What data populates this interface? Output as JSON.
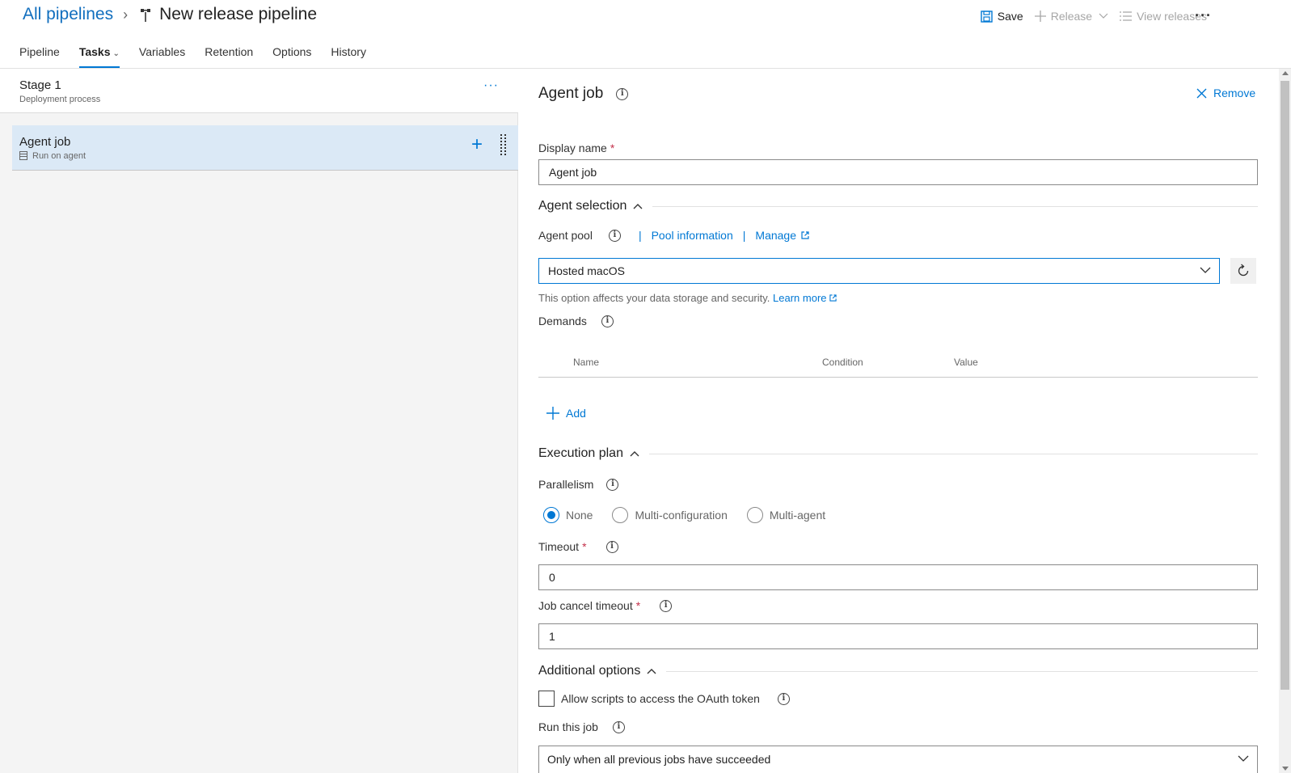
{
  "breadcrumb": {
    "parent": "All pipelines",
    "title": "New release pipeline"
  },
  "toolbar": {
    "save_label": "Save",
    "release_label": "Release",
    "view_releases_label": "View releases",
    "more_label": "···"
  },
  "tabs": [
    {
      "label": "Pipeline"
    },
    {
      "label": "Tasks"
    },
    {
      "label": "Variables"
    },
    {
      "label": "Retention"
    },
    {
      "label": "Options"
    },
    {
      "label": "History"
    }
  ],
  "left_panel": {
    "stage_title": "Stage 1",
    "stage_subtitle": "Deployment process",
    "stage_more": "···",
    "job_title": "Agent job",
    "job_subtitle": "Run on agent",
    "job_add": "+"
  },
  "right_panel": {
    "title": "Agent job",
    "remove_label": "Remove",
    "display_name_label": "Display name",
    "display_name_value": "Agent job",
    "agent_selection_label": "Agent selection",
    "agent_pool_label": "Agent pool",
    "pool_information_link": "Pool information",
    "manage_link": "Manage",
    "agent_pool_value": "Hosted macOS",
    "help_text": "This option affects your data storage and security.",
    "learn_more_link": "Learn more",
    "demands_label": "Demands",
    "demands_columns": [
      "Name",
      "Condition",
      "Value"
    ],
    "add_label": "Add",
    "execution_plan_label": "Execution plan",
    "parallelism_label": "Parallelism",
    "parallelism_options": [
      "None",
      "Multi-configuration",
      "Multi-agent"
    ],
    "parallelism_selected": "None",
    "timeout_label": "Timeout",
    "timeout_value": "0",
    "job_cancel_timeout_label": "Job cancel timeout",
    "job_cancel_timeout_value": "1",
    "additional_options_label": "Additional options",
    "oauth_checkbox_label": "Allow scripts to access the OAuth token",
    "oauth_checked": false,
    "run_this_job_label": "Run this job",
    "run_this_job_value": "Only when all previous jobs have succeeded"
  },
  "colors": {
    "accent": "#0078d4",
    "selected_item_bg": "#dbe9f6",
    "required": "#c4314b"
  }
}
